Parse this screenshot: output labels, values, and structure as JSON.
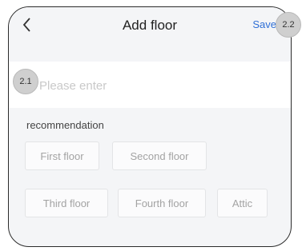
{
  "header": {
    "title": "Add floor",
    "save_label": "Save"
  },
  "input": {
    "placeholder": "Please enter",
    "value": ""
  },
  "recommendation": {
    "title": "recommendation",
    "chips": [
      "First floor",
      "Second floor",
      "Third floor",
      "Fourth floor",
      "Attic"
    ]
  },
  "annotations": {
    "input_badge": "2.1",
    "save_badge": "2.2"
  }
}
